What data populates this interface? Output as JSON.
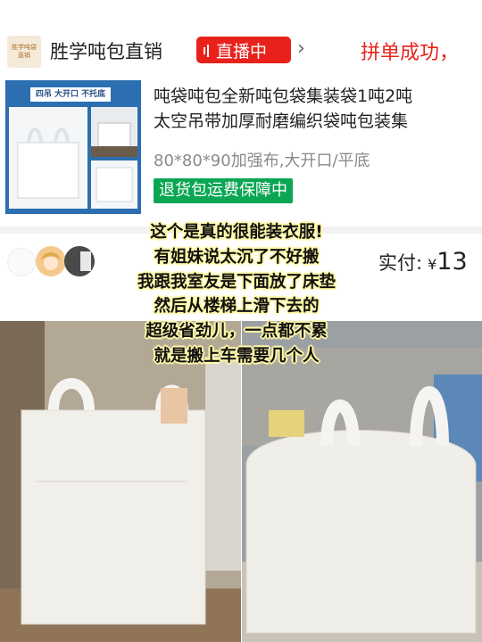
{
  "shop": {
    "logo_text": "胜学吨袋直销",
    "name": "胜学吨包直销",
    "live_label": "直播中",
    "order_status": "拼单成功，"
  },
  "product": {
    "image_banner": "四吊 大开口 不托底",
    "title_line1": "吨袋吨包全新吨包袋集装袋1吨2吨",
    "title_line2": "太空吊带加厚耐磨编织袋吨包装集",
    "spec": "80*80*90加强布,大开口/平底",
    "tag": "退货包运费保障中"
  },
  "order": {
    "paid_label": "实付:",
    "currency": "¥",
    "amount": "13"
  },
  "caption": {
    "lines": [
      "这个是真的很能装衣服!",
      "有姐妹说太沉了不好搬",
      "我跟我室友是下面放了床垫",
      "然后从楼梯上滑下去的",
      "超级省劲儿，一点都不累",
      "就是搬上车需要几个人"
    ]
  },
  "icons": {
    "live": "live-bars-icon",
    "chevron": "chevron-right-icon"
  },
  "colors": {
    "live_red": "#e8221b",
    "order_red": "#e8231d",
    "tag_green": "#0aa653",
    "caption_highlight": "#fff7a8"
  }
}
